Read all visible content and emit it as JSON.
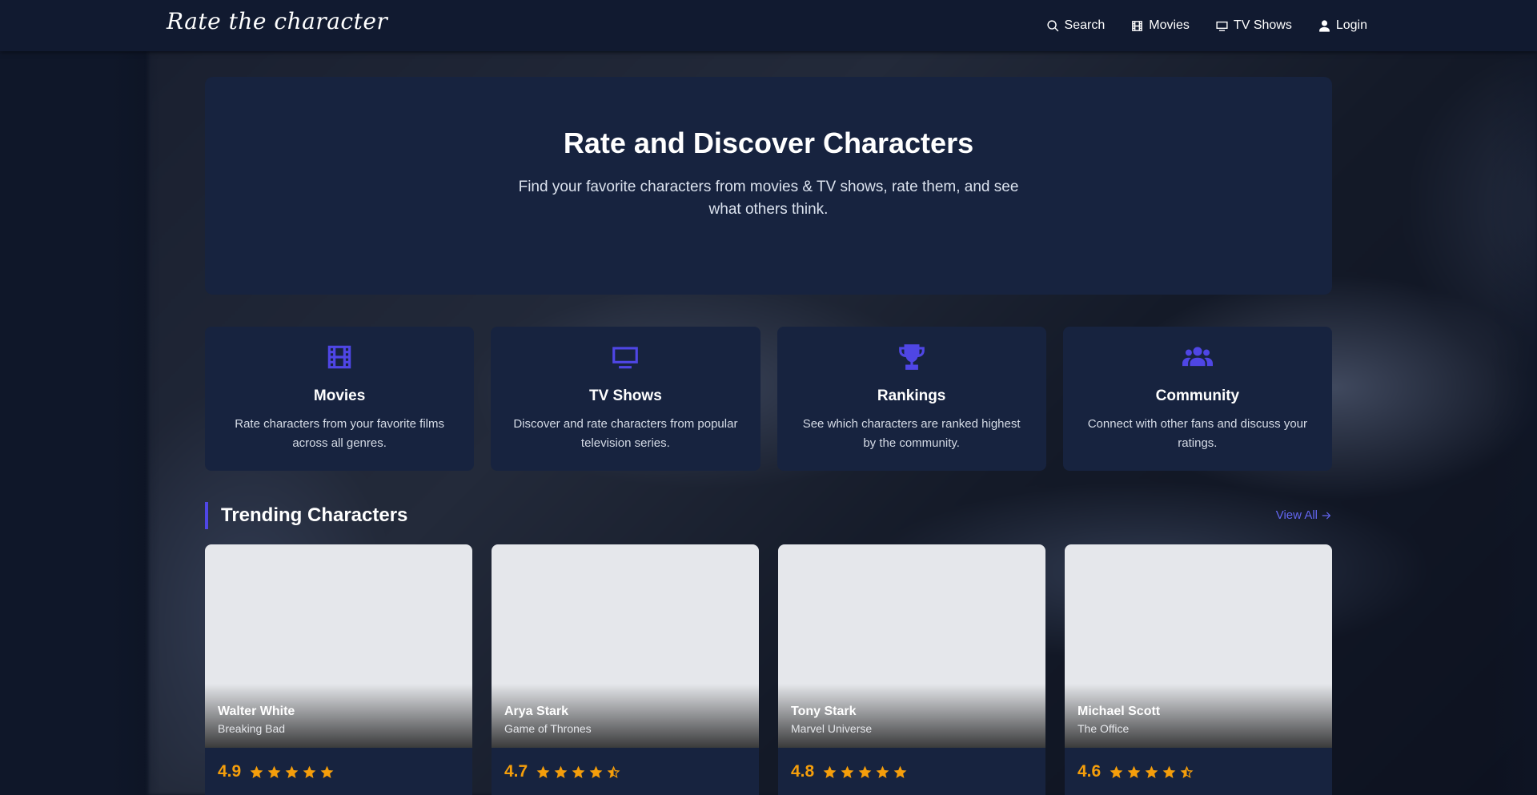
{
  "brand": {
    "name": "Rate the character"
  },
  "nav": {
    "search": "Search",
    "movies": "Movies",
    "tv_shows": "TV Shows",
    "login": "Login"
  },
  "hero": {
    "title": "Rate and Discover Characters",
    "subtitle": "Find your favorite characters from movies & TV shows, rate them, and see what others think."
  },
  "features": [
    {
      "icon": "film-icon",
      "title": "Movies",
      "desc": "Rate characters from your favorite films across all genres."
    },
    {
      "icon": "tv-icon",
      "title": "TV Shows",
      "desc": "Discover and rate characters from popular television series."
    },
    {
      "icon": "trophy-icon",
      "title": "Rankings",
      "desc": "See which characters are ranked highest by the community."
    },
    {
      "icon": "users-icon",
      "title": "Community",
      "desc": "Connect with other fans and discuss your ratings."
    }
  ],
  "trending": {
    "title": "Trending Characters",
    "view_all": "View All",
    "cards": [
      {
        "name": "Walter White",
        "show": "Breaking Bad",
        "rating": "4.9",
        "stars": 5
      },
      {
        "name": "Arya Stark",
        "show": "Game of Thrones",
        "rating": "4.7",
        "stars": 4.5
      },
      {
        "name": "Tony Stark",
        "show": "Marvel Universe",
        "rating": "4.8",
        "stars": 5
      },
      {
        "name": "Michael Scott",
        "show": "The Office",
        "rating": "4.6",
        "stars": 4.5
      }
    ]
  },
  "colors": {
    "accent": "#4f46e5",
    "star": "#f59e0b",
    "panel": "#17233f",
    "navbar": "#111a30"
  }
}
